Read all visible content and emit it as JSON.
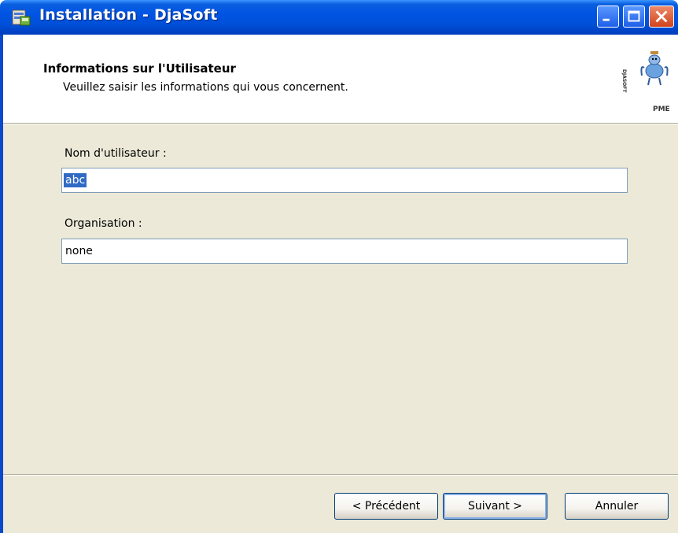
{
  "window": {
    "title": "Installation - DjaSoft"
  },
  "header": {
    "title": "Informations sur l'Utilisateur",
    "subtitle": "Veuillez saisir les informations qui vous concernent.",
    "logo_vertical_text": "DJASOFT",
    "logo_text": "PME"
  },
  "form": {
    "username_label": "Nom d'utilisateur :",
    "username_value": "abc",
    "organization_label": "Organisation :",
    "organization_value": "none"
  },
  "buttons": {
    "previous": "< Précédent",
    "next": "Suivant >",
    "cancel": "Annuler"
  },
  "colors": {
    "titlebar": "#0054e3",
    "dialog_bg": "#ece9d8",
    "selection": "#316ac5"
  }
}
